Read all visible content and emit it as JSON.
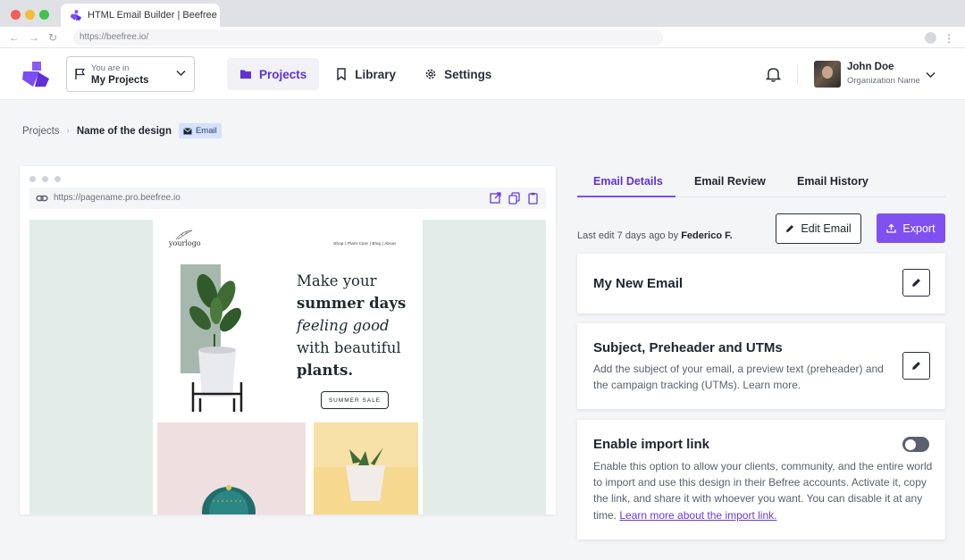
{
  "browser": {
    "tab_title": "HTML Email Builder | Beefree",
    "url": "https://beefree.io/"
  },
  "header": {
    "project_select": {
      "label": "You are in",
      "value": "My Projects"
    },
    "nav": [
      {
        "label": "Projects",
        "icon": "folder-icon",
        "active": true
      },
      {
        "label": "Library",
        "icon": "bookmark-icon",
        "active": false
      },
      {
        "label": "Settings",
        "icon": "gear-icon",
        "active": false
      }
    ],
    "user": {
      "name": "John Doe",
      "org": "Organization Name"
    }
  },
  "breadcrumb": {
    "root": "Projects",
    "current": "Name of the design",
    "badge": "Email"
  },
  "preview": {
    "url": "https://pagename.pro.beefree.io",
    "email": {
      "logo": "yourlogo",
      "menu": "Shop  |  Plant Care  |  Blog  |  About",
      "headline": [
        "Make your",
        "summer days",
        "feeling good",
        "with beautiful",
        "plants."
      ],
      "button": "SUMMER SALE"
    }
  },
  "panel": {
    "tabs": [
      "Email Details",
      "Email Review",
      "Email History"
    ],
    "active_tab": "Email Details",
    "last_edit_prefix": "Last edit 7 days ago by",
    "last_edit_user": "Federico F.",
    "edit_button": "Edit Email",
    "export_button": "Export",
    "cards": {
      "name": {
        "title": "My New Email"
      },
      "subject": {
        "title": "Subject, Preheader and UTMs",
        "desc": "Add the subject of your email, a preview text (preheader) and the campaign tracking (UTMs). Learn more."
      },
      "import": {
        "title": "Enable import link",
        "desc": "Enable this option to allow your clients, community, and the entire world to import and use this design in their Befree accounts. Activate it, copy the link, and share it with whoever you want. You can disable it at any time.",
        "link": "Learn more about the import link.",
        "enabled": false
      }
    }
  },
  "colors": {
    "accent": "#5f32d6",
    "export": "#8150f0",
    "badge": "#d5e2fb"
  }
}
